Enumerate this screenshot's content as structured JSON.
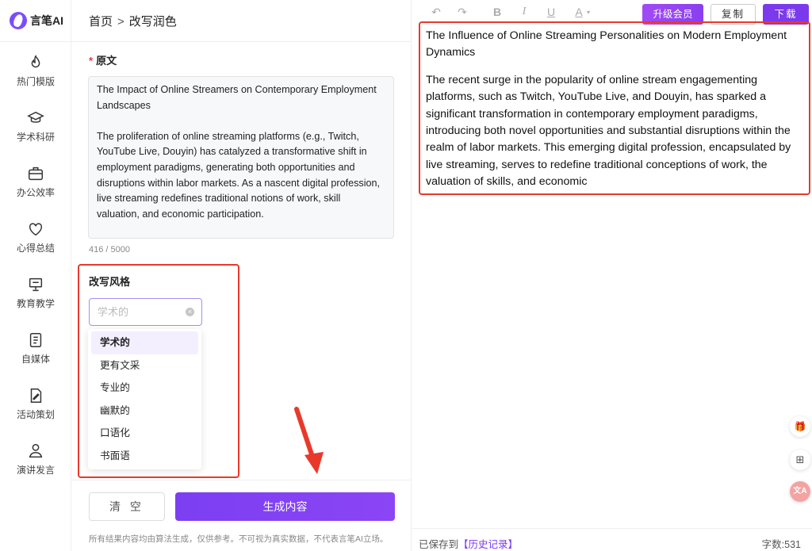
{
  "app": {
    "logo_text": "言笔AI",
    "accent": "#7c3aed",
    "highlight": "#e8392b"
  },
  "sidebar": {
    "items": [
      {
        "label": "热门模版",
        "icon": "flame-icon"
      },
      {
        "label": "学术科研",
        "icon": "graduation-cap-icon"
      },
      {
        "label": "办公效率",
        "icon": "briefcase-icon"
      },
      {
        "label": "心得总结",
        "icon": "heart-icon"
      },
      {
        "label": "教育教学",
        "icon": "presentation-board-icon"
      },
      {
        "label": "自媒体",
        "icon": "document-icon"
      },
      {
        "label": "活动策划",
        "icon": "edit-document-icon"
      },
      {
        "label": "演讲发言",
        "icon": "speaker-icon"
      }
    ]
  },
  "breadcrumb": {
    "home": "首页",
    "separator": ">",
    "current": "改写润色"
  },
  "source": {
    "label": "原文",
    "required_mark": "*",
    "title": "The Impact of Online Streamers on Contemporary Employment Landscapes",
    "body": "The proliferation of online streaming platforms (e.g., Twitch, YouTube Live, Douyin) has catalyzed a transformative shift in employment paradigms, generating both opportunities and disruptions within labor markets. As a nascent digital profession, live streaming redefines traditional notions of work, skill valuation, and economic participation.",
    "counter": "416 / 5000"
  },
  "style": {
    "label": "改写风格",
    "placeholder": "学术的",
    "options": [
      "学术的",
      "更有文采",
      "专业的",
      "幽默的",
      "口语化",
      "书面语"
    ],
    "selected": "学术的"
  },
  "actions": {
    "clear_label": "清 空",
    "generate_label": "生成内容"
  },
  "disclaimer": "所有结果内容均由算法生成，仅供参考。不可视为真实数据，不代表言笔AI立场。",
  "editor": {
    "toolbar": {
      "undo": "↶",
      "redo": "↷",
      "bold": "B",
      "italic": "I",
      "underline": "U",
      "font_color": "A"
    },
    "upgrade_label": "升级会员",
    "copy_label": "复制",
    "download_label": "下载",
    "output_title": "The Influence of Online Streaming Personalities on Modern Employment Dynamics",
    "output_body": "The recent surge in the popularity of online stream engagementing platforms, such as Twitch, YouTube Live, and Douyin, has sparked a significant transformation in contemporary employment paradigms, introducing both novel opportunities and substantial disruptions within the realm of labor markets. This emerging digital profession, encapsulated by live streaming, serves to redefine traditional conceptions of work, the valuation of skills, and economic",
    "saved_prefix": "已保存到",
    "history_link": "【历史记录】",
    "word_count": "字数:531"
  }
}
